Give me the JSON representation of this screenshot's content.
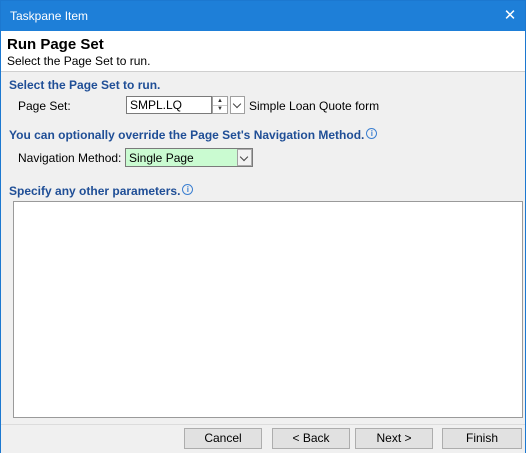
{
  "window": {
    "title": "Taskpane Item",
    "close_glyph": "✕"
  },
  "header": {
    "title": "Run Page Set",
    "subtitle": "Select the Page Set to run."
  },
  "section1": {
    "title": "Select the Page Set to run.",
    "page_set_label": "Page Set:",
    "page_set_value": "SMPL.LQ",
    "page_set_description": "Simple Loan Quote form"
  },
  "section2": {
    "title": "You can optionally override the Page Set's Navigation Method.",
    "nav_label": "Navigation Method:",
    "nav_value": "Single Page",
    "nav_bg_color": "#cafbd1"
  },
  "section3": {
    "title": "Specify any other parameters.",
    "params_value": ""
  },
  "info_icon_glyph": "i",
  "buttons": {
    "cancel": "Cancel",
    "back": "< Back",
    "next": "Next >",
    "finish": "Finish"
  }
}
